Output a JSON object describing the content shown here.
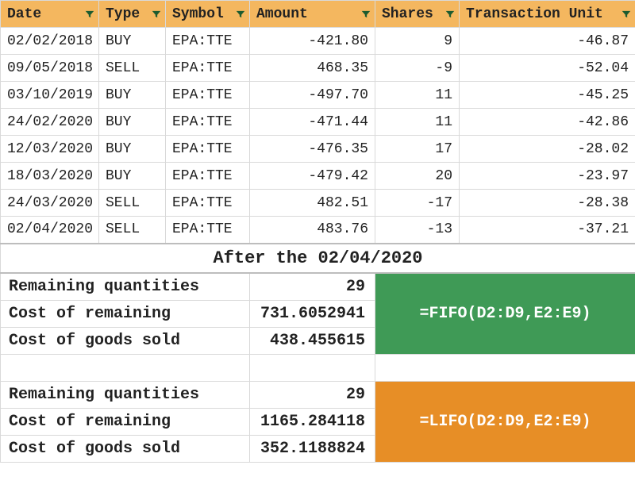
{
  "headers": {
    "date": "Date",
    "type": "Type",
    "symbol": "Symbol",
    "amount": "Amount",
    "shares": "Shares",
    "transaction_unit": "Transaction Unit"
  },
  "rows": [
    {
      "date": "02/02/2018",
      "type": "BUY",
      "symbol": "EPA:TTE",
      "amount": "-421.80",
      "shares": "9",
      "tunit": "-46.87"
    },
    {
      "date": "09/05/2018",
      "type": "SELL",
      "symbol": "EPA:TTE",
      "amount": "468.35",
      "shares": "-9",
      "tunit": "-52.04"
    },
    {
      "date": "03/10/2019",
      "type": "BUY",
      "symbol": "EPA:TTE",
      "amount": "-497.70",
      "shares": "11",
      "tunit": "-45.25"
    },
    {
      "date": "24/02/2020",
      "type": "BUY",
      "symbol": "EPA:TTE",
      "amount": "-471.44",
      "shares": "11",
      "tunit": "-42.86"
    },
    {
      "date": "12/03/2020",
      "type": "BUY",
      "symbol": "EPA:TTE",
      "amount": "-476.35",
      "shares": "17",
      "tunit": "-28.02"
    },
    {
      "date": "18/03/2020",
      "type": "BUY",
      "symbol": "EPA:TTE",
      "amount": "-479.42",
      "shares": "20",
      "tunit": "-23.97"
    },
    {
      "date": "24/03/2020",
      "type": "SELL",
      "symbol": "EPA:TTE",
      "amount": "482.51",
      "shares": "-17",
      "tunit": "-28.38"
    },
    {
      "date": "02/04/2020",
      "type": "SELL",
      "symbol": "EPA:TTE",
      "amount": "483.76",
      "shares": "-13",
      "tunit": "-37.21"
    }
  ],
  "section_title": "After the 02/04/2020",
  "metrics": {
    "labels": {
      "remaining_qty": "Remaining quantities",
      "cost_remaining": "Cost of remaining",
      "cogs": "Cost of goods sold"
    },
    "fifo": {
      "remaining_qty": "29",
      "cost_remaining": "731.6052941",
      "cogs": "438.455615",
      "formula": "=FIFO(D2:D9,E2:E9)"
    },
    "lifo": {
      "remaining_qty": "29",
      "cost_remaining": "1165.284118",
      "cogs": "352.1188824",
      "formula": "=LIFO(D2:D9,E2:E9)"
    }
  },
  "chart_data": {
    "type": "table",
    "columns": [
      "Date",
      "Type",
      "Symbol",
      "Amount",
      "Shares",
      "Transaction Unit"
    ],
    "data": [
      [
        "02/02/2018",
        "BUY",
        "EPA:TTE",
        -421.8,
        9,
        -46.87
      ],
      [
        "09/05/2018",
        "SELL",
        "EPA:TTE",
        468.35,
        -9,
        -52.04
      ],
      [
        "03/10/2019",
        "BUY",
        "EPA:TTE",
        -497.7,
        11,
        -45.25
      ],
      [
        "24/02/2020",
        "BUY",
        "EPA:TTE",
        -471.44,
        11,
        -42.86
      ],
      [
        "12/03/2020",
        "BUY",
        "EPA:TTE",
        -476.35,
        17,
        -28.02
      ],
      [
        "18/03/2020",
        "BUY",
        "EPA:TTE",
        -479.42,
        20,
        -23.97
      ],
      [
        "24/03/2020",
        "SELL",
        "EPA:TTE",
        482.51,
        -17,
        -28.38
      ],
      [
        "02/04/2020",
        "SELL",
        "EPA:TTE",
        483.76,
        -13,
        -37.21
      ]
    ],
    "summaries": {
      "FIFO": {
        "remaining_quantities": 29,
        "cost_of_remaining": 731.6052941,
        "cost_of_goods_sold": 438.455615
      },
      "LIFO": {
        "remaining_quantities": 29,
        "cost_of_remaining": 1165.284118,
        "cost_of_goods_sold": 352.1188824
      }
    }
  }
}
